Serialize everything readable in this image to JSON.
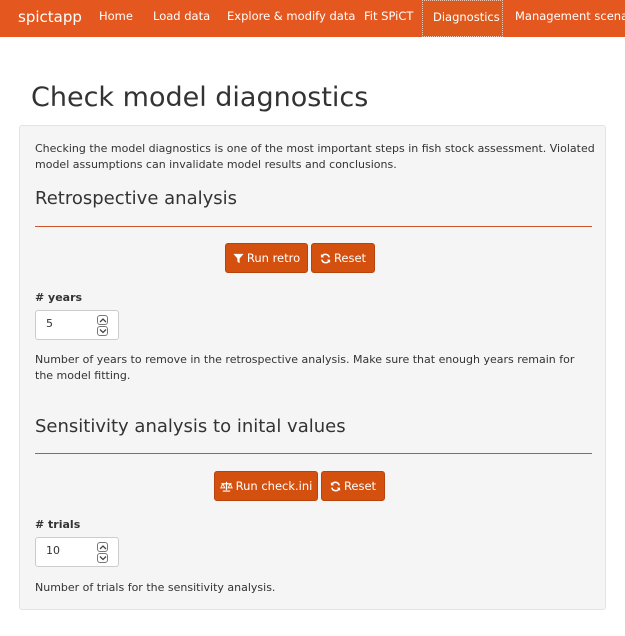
{
  "nav": {
    "brand": "spictapp",
    "items": [
      {
        "label": "Home"
      },
      {
        "label": "Load data"
      },
      {
        "label": "Explore & modify data"
      },
      {
        "label": "Fit SPiCT"
      },
      {
        "label": "Diagnostics",
        "active": true
      },
      {
        "label": "Management scenario"
      }
    ]
  },
  "page": {
    "title": "Check model diagnostics",
    "intro": "Checking the model diagnostics is one of the most important steps in fish stock assessment. Violated model assumptions can invalidate model results and conclusions."
  },
  "retro": {
    "heading": "Retrospective analysis",
    "run_label": "Run retro",
    "run_icon": "filter-icon",
    "reset_label": "Reset",
    "reset_icon": "refresh-icon",
    "input_label": "# years",
    "input_value": "5",
    "help": "Number of years to remove in the retrospective analysis. Make sure that enough years remain for the model fitting."
  },
  "sensitivity": {
    "heading": "Sensitivity analysis to inital values",
    "run_label": "Run check.ini",
    "run_icon": "balance-scale-icon",
    "reset_label": "Reset",
    "reset_icon": "refresh-icon",
    "input_label": "# trials",
    "input_value": "10",
    "help": "Number of trials for the sensitivity analysis."
  },
  "colors": {
    "navbar": "#e4571f",
    "button": "#d4500f",
    "rule": "#c9542a",
    "well": "#f5f5f5"
  }
}
